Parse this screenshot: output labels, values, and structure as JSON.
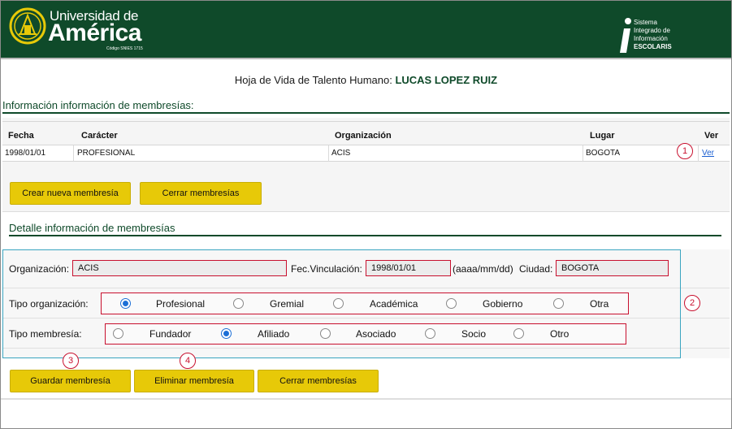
{
  "header": {
    "logo_line1": "Universidad de",
    "logo_line2": "América",
    "logo_code": "Código SNIES 1715",
    "system_lines": [
      "Sistema",
      "Integrado de",
      "Información"
    ],
    "system_name": "ESCOLARIS"
  },
  "page": {
    "title_prefix": "Hoja de Vida de Talento Humano: ",
    "title_name": "LUCAS LOPEZ RUIZ"
  },
  "list_section": {
    "title": "Información información de membresías:",
    "columns": [
      "Fecha",
      "Carácter",
      "Organización",
      "Lugar",
      "Ver"
    ],
    "rows": [
      {
        "fecha": "1998/01/01",
        "caracter": "PROFESIONAL",
        "organizacion": "ACIS",
        "lugar": "BOGOTA",
        "ver": "Ver"
      }
    ],
    "buttons": {
      "new": "Crear nueva membresía",
      "close": "Cerrar membresías"
    }
  },
  "detail_section": {
    "title": "Detalle información de membresías",
    "organizacion_label": "Organización:",
    "organizacion_value": "ACIS",
    "fec_label": "Fec.Vinculación:",
    "fec_value": "1998/01/01",
    "fec_format": "(aaaa/mm/dd)",
    "ciudad_label": "Ciudad:",
    "ciudad_value": "BOGOTA",
    "tipo_org_label": "Tipo organización:",
    "tipo_org_options": [
      "Profesional",
      "Gremial",
      "Académica",
      "Gobierno",
      "Otra"
    ],
    "tipo_org_selected": "Profesional",
    "tipo_mem_label": "Tipo membresía:",
    "tipo_mem_options": [
      "Fundador",
      "Afiliado",
      "Asociado",
      "Socio",
      "Otro"
    ],
    "tipo_mem_selected": "Afiliado",
    "buttons": {
      "save": "Guardar membresía",
      "delete": "Eliminar membresía",
      "close": "Cerrar membresías"
    }
  },
  "callouts": [
    "1",
    "2",
    "3",
    "4"
  ],
  "colors": {
    "brand_green": "#0f4a2a",
    "button_yellow": "#e7c908",
    "annotation_red": "#c8102e",
    "link_blue": "#1a5fd1"
  }
}
